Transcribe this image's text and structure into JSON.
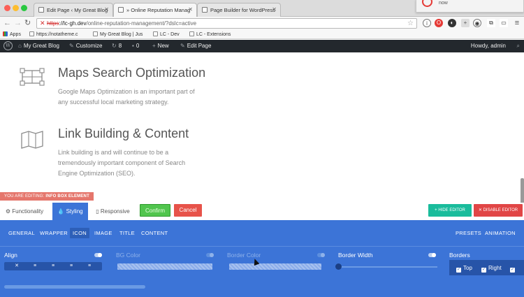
{
  "browser": {
    "tabs": [
      {
        "title": "Edit Page ‹ My Great Blog",
        "active": false
      },
      {
        "title": "» Online Reputation Manag",
        "active": true
      },
      {
        "title": "Page Builder for WordPress",
        "active": false
      }
    ],
    "notification": {
      "text": "now"
    },
    "url": {
      "protocol": "https",
      "host": "://lc-gh.dev",
      "path": "/online-reputation-management/?dslc=active"
    },
    "bookmarks": [
      {
        "label": "Apps"
      },
      {
        "label": "https://notatheme.c"
      },
      {
        "label": "My Great Blog | Jus"
      },
      {
        "label": "LC - Dev"
      },
      {
        "label": "LC - Extensions"
      }
    ]
  },
  "wp_admin_bar": {
    "site_name": "My Great Blog",
    "customize": "Customize",
    "updates_count": "8",
    "comments_count": "0",
    "new": "New",
    "edit_page": "Edit Page",
    "greeting": "Howdy, admin"
  },
  "features": [
    {
      "icon": "map-grid-icon",
      "title": "Maps Search Optimization",
      "text_lines": [
        "Google Maps Optimization is an important part of",
        "any successful local marketing strategy."
      ]
    },
    {
      "icon": "folded-map-icon",
      "title": "Link Building & Content",
      "text_lines": [
        "Link building is and will continue to be a",
        "tremendously important component of Search",
        "Engine Optimization (SEO)."
      ]
    }
  ],
  "editor": {
    "editing_prefix": "You are editing:",
    "editing_element": "Info Box Element",
    "tabs": [
      {
        "label": "Functionality",
        "icon": "gear-icon",
        "active": false
      },
      {
        "label": "Styling",
        "icon": "drop-icon",
        "active": true
      },
      {
        "label": "Responsive",
        "icon": "mobile-icon",
        "active": false
      }
    ],
    "confirm_label": "Confirm",
    "cancel_label": "Cancel",
    "hide_editor_label": "Hide Editor",
    "disable_editor_label": "Disable Editor",
    "subnav_left": [
      "GENERAL",
      "WRAPPER",
      "ICON",
      "IMAGE",
      "TITLE",
      "CONTENT"
    ],
    "subnav_active": "ICON",
    "subnav_right": [
      "PRESETS",
      "ANIMATION"
    ],
    "controls": {
      "align": "Align",
      "bg_color": "BG Color",
      "border_color": "Border Color",
      "border_width": "Border Width",
      "borders": "Borders"
    },
    "align_options": [
      "✕",
      "≡",
      "≡",
      "≡",
      "≡"
    ],
    "border_checks": [
      {
        "label": "Top",
        "checked": true
      },
      {
        "label": "Right",
        "checked": true
      },
      {
        "label": "",
        "checked": true
      }
    ],
    "border_width_value": 0
  },
  "colors": {
    "panel_blue": "#3c74d7",
    "confirm_green": "#51c54e",
    "cancel_red": "#e7534a",
    "hide_editor_teal": "#1abc9c",
    "disable_editor_red": "#e14646",
    "wp_bar": "#23282d"
  }
}
